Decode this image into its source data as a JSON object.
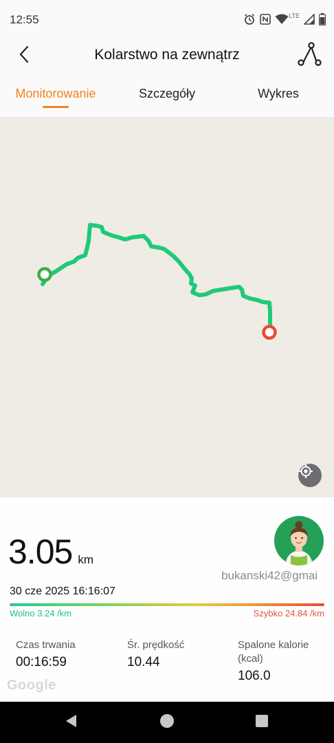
{
  "status_bar": {
    "time": "12:55",
    "network": "LTE",
    "icons": [
      "alarm-icon",
      "nfc-icon",
      "wifi-icon",
      "signal-icon",
      "battery-icon"
    ]
  },
  "header": {
    "title": "Kolarstwo na zewnątrz",
    "back_icon": "chevron-left-icon",
    "route_icon": "route-icon"
  },
  "tabs": [
    {
      "label": "Monitorowanie",
      "active": true
    },
    {
      "label": "Szczegóły",
      "active": false
    },
    {
      "label": "Wykres",
      "active": false
    }
  ],
  "map": {
    "route_color": "#1fc97a",
    "start_marker_color": "#3cae4a",
    "end_marker_color": "#ef4a30",
    "locate_icon": "crosshair-icon"
  },
  "summary": {
    "distance": "3.05",
    "distance_unit": "km",
    "username": "bukanski42@gmai",
    "date": "30 cze 2025 16:16:07",
    "slow_label": "Wolno 3.24 /km",
    "fast_label": "Szybko 24.84 /km"
  },
  "stats": [
    {
      "label": "Czas trwania",
      "value": "00:16:59"
    },
    {
      "label": "Śr. prędkość",
      "value": "10.44"
    },
    {
      "label": "Spalone kalorie (kcal)",
      "value": "106.0"
    }
  ],
  "map_attribution": "Google",
  "nav_bar": {
    "icons": [
      "back-triangle-icon",
      "home-circle-icon",
      "recents-square-icon"
    ]
  },
  "colors": {
    "accent": "#f0841c",
    "slow": "#1fbf8f",
    "fast": "#e0553f",
    "avatar_bg": "#25a057"
  }
}
